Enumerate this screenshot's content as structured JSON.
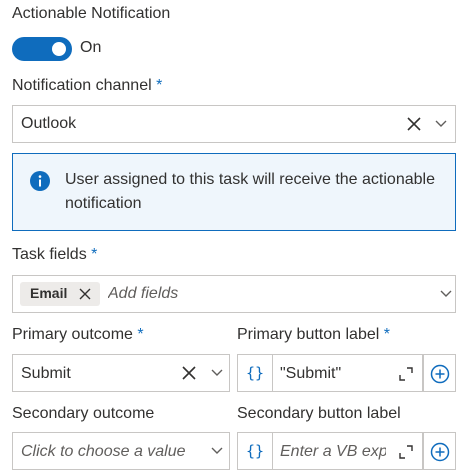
{
  "actionable": {
    "label": "Actionable Notification",
    "toggle_state": "On",
    "toggle_on": true
  },
  "channel": {
    "label": "Notification channel",
    "required_mark": "*",
    "value": "Outlook"
  },
  "info": {
    "text": "User assigned to this task will receive the actionable notification"
  },
  "task_fields": {
    "label": "Task fields",
    "required_mark": "*",
    "chip": "Email",
    "placeholder": "Add fields"
  },
  "primary_outcome": {
    "label": "Primary outcome",
    "required_mark": "*",
    "value": "Submit"
  },
  "primary_button": {
    "label": "Primary button label",
    "required_mark": "*",
    "value": "\"Submit\"",
    "expr_glyph": "{}"
  },
  "secondary_outcome": {
    "label": "Secondary outcome",
    "placeholder": "Click to choose a value"
  },
  "secondary_button": {
    "label": "Secondary button label",
    "placeholder": "Enter a VB expression",
    "expr_glyph": "{}"
  },
  "colors": {
    "accent": "#0f6cbd",
    "info_bg": "#eff6fc",
    "border": "#c8c6c4"
  }
}
